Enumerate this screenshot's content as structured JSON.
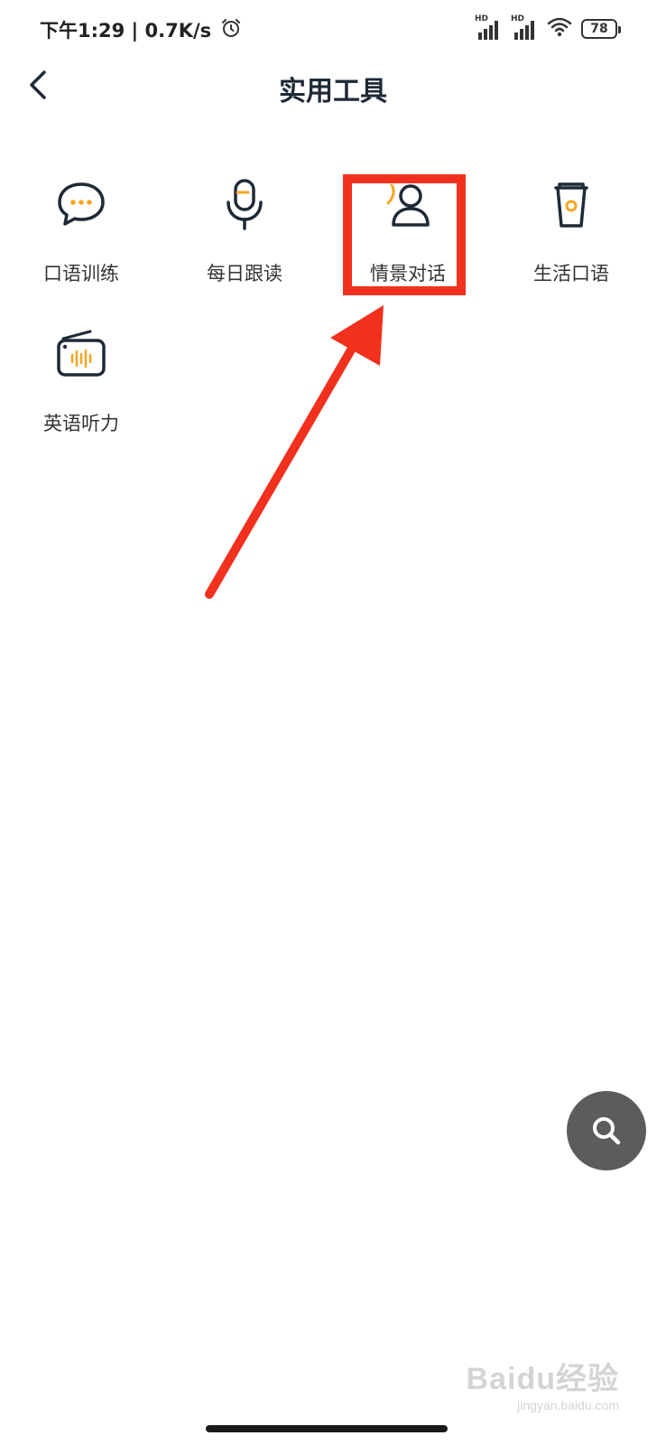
{
  "status_bar": {
    "time_speed": "下午1:29 | 0.7K/s",
    "signal_label_1": "HD",
    "signal_label_2": "HD",
    "battery": "78"
  },
  "header": {
    "title": "实用工具"
  },
  "tools": [
    {
      "label": "口语训练",
      "icon": "chat-bubble-icon"
    },
    {
      "label": "每日跟读",
      "icon": "microphone-icon"
    },
    {
      "label": "情景对话",
      "icon": "person-dialogue-icon"
    },
    {
      "label": "生活口语",
      "icon": "cup-icon"
    },
    {
      "label": "英语听力",
      "icon": "radio-icon"
    }
  ],
  "colors": {
    "accent": "#f5a623",
    "icon_stroke": "#1f2a37",
    "annotation_red": "#f2301e",
    "fab_bg": "#5c5c5c"
  },
  "watermark": {
    "brand": "Baidu经验",
    "sub": "jingyan.baidu.com"
  }
}
